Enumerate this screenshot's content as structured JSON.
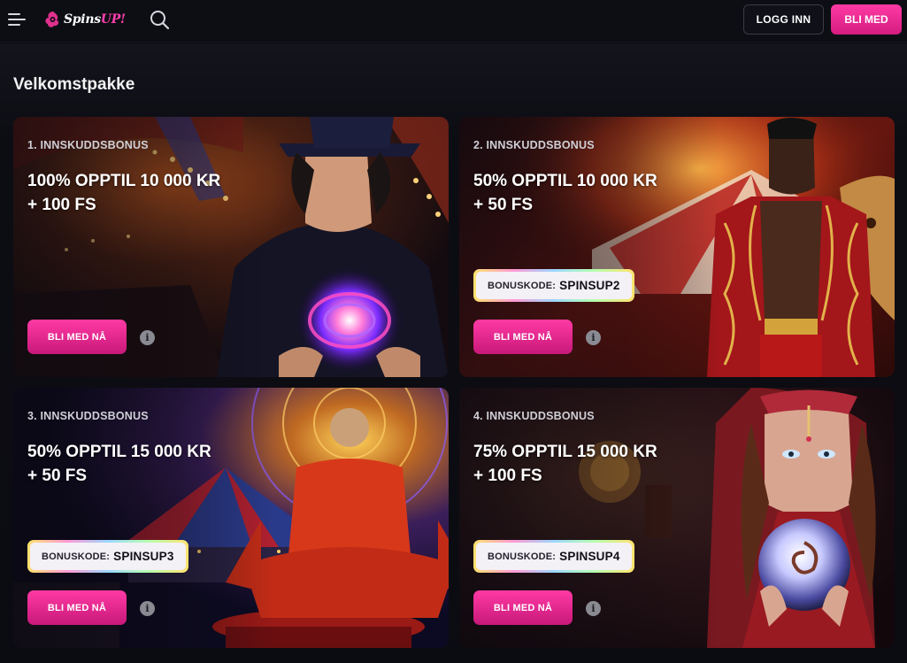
{
  "header": {
    "logo": {
      "name": "Spins",
      "accent": "UP!"
    },
    "login_label": "LOGG INN",
    "join_label": "BLI MED"
  },
  "section": {
    "title": "Velkomstpakke"
  },
  "cards": [
    {
      "label": "1. INNSKUDDSBONUS",
      "offer_line1": "100% OPPTIL 10 000 KR",
      "offer_line2": "+ 100 FS",
      "button_label": "BLI MED NÅ",
      "theme": "magician"
    },
    {
      "label": "2. INNSKUDDSBONUS",
      "offer_line1": "50% OPPTIL 10 000 KR",
      "offer_line2": "+ 50 FS",
      "bonus_code_label": "BONUSKODE:",
      "bonus_code": "SPINSUP2",
      "button_label": "BLI MED NÅ",
      "theme": "ringmaster"
    },
    {
      "label": "3. INNSKUDDSBONUS",
      "offer_line1": "50% OPPTIL 15 000 KR",
      "offer_line2": "+ 50 FS",
      "bonus_code_label": "BONUSKODE:",
      "bonus_code": "SPINSUP3",
      "button_label": "BLI MED NÅ",
      "theme": "monk"
    },
    {
      "label": "4. INNSKUDDSBONUS",
      "offer_line1": "75% OPPTIL 15 000 KR",
      "offer_line2": "+ 100 FS",
      "bonus_code_label": "BONUSKODE:",
      "bonus_code": "SPINSUP4",
      "button_label": "BLI MED NÅ",
      "theme": "fortune-teller"
    }
  ],
  "colors": {
    "accent": "#ff3aa4",
    "background": "#0b0c12"
  }
}
